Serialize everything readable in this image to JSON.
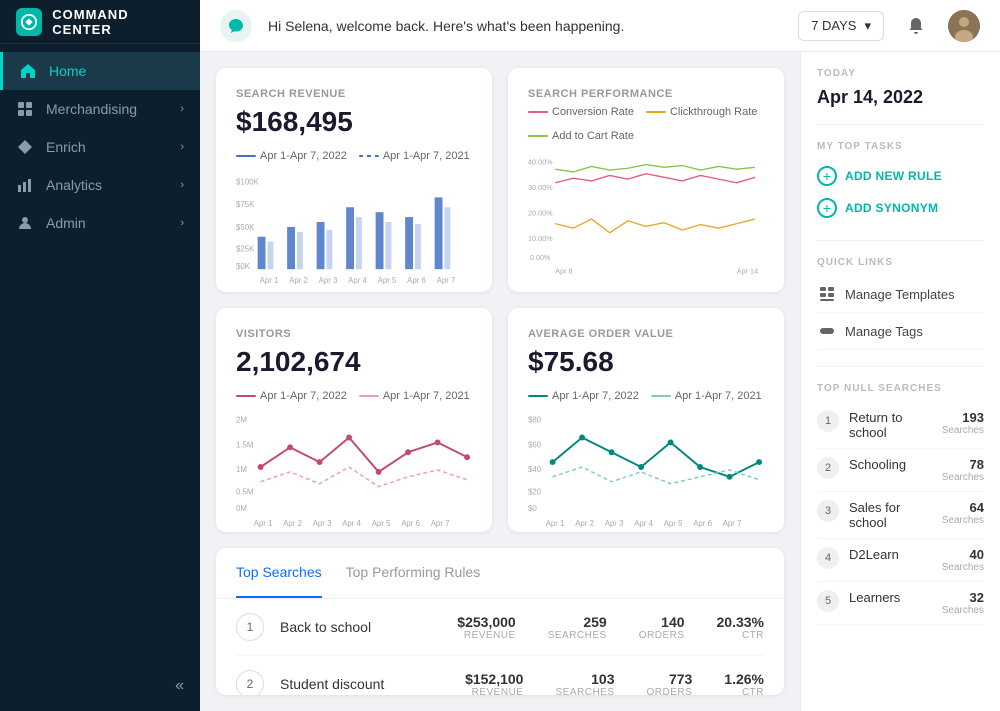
{
  "sidebar": {
    "title": "COMMAND CENTER",
    "items": [
      {
        "label": "Home",
        "active": true,
        "hasChevron": false
      },
      {
        "label": "Merchandising",
        "active": false,
        "hasChevron": true
      },
      {
        "label": "Enrich",
        "active": false,
        "hasChevron": true
      },
      {
        "label": "Analytics",
        "active": false,
        "hasChevron": true
      },
      {
        "label": "Admin",
        "active": false,
        "hasChevron": true
      }
    ]
  },
  "topbar": {
    "greeting": "Hi Selena, welcome back. Here's what's been happening.",
    "filter": "7 DAYS"
  },
  "cards": {
    "search_revenue": {
      "title": "SEARCH REVENUE",
      "value": "$168,495",
      "legend1": "Apr 1-Apr 7, 2022",
      "legend2": "Apr 1-Apr 7, 2021"
    },
    "search_performance": {
      "title": "SEARCH PERFORMANCE",
      "legend1": "Conversion Rate",
      "legend2": "Clickthrough Rate",
      "legend3": "Add to Cart Rate"
    },
    "visitors": {
      "title": "VISITORS",
      "value": "2,102,674",
      "legend1": "Apr 1-Apr 7, 2022",
      "legend2": "Apr 1-Apr 7, 2021"
    },
    "avg_order": {
      "title": "AVERAGE ORDER VALUE",
      "value": "$75.68",
      "legend1": "Apr 1-Apr 7, 2022",
      "legend2": "Apr 1-Apr 7, 2021"
    }
  },
  "bottom_tabs": [
    "Top Searches",
    "Top Performing Rules"
  ],
  "top_searches": [
    {
      "rank": 1,
      "name": "Back to school",
      "revenue": "$253,000",
      "searches": "259",
      "orders": "140",
      "ctr": "20.33%"
    },
    {
      "rank": 2,
      "name": "Student discount",
      "revenue": "$152,100",
      "searches": "103",
      "orders": "773",
      "ctr": "1.26%"
    }
  ],
  "right_panel": {
    "today_label": "TODAY",
    "date": "Apr 14, 2022",
    "tasks_label": "MY TOP TASKS",
    "add_rule": "ADD NEW RULE",
    "add_synonym": "ADD SYNONYM",
    "quick_links_label": "QUICK LINKS",
    "quick_links": [
      "Manage Templates",
      "Manage Tags"
    ],
    "null_searches_label": "TOP NULL SEARCHES",
    "null_searches": [
      {
        "rank": 1,
        "name": "Return to school",
        "count": "193",
        "label": "Searches"
      },
      {
        "rank": 2,
        "name": "Schooling",
        "count": "78",
        "label": "Searches"
      },
      {
        "rank": 3,
        "name": "Sales for school",
        "count": "64",
        "label": "Searches"
      },
      {
        "rank": 4,
        "name": "D2Learn",
        "count": "40",
        "label": "Searches"
      },
      {
        "rank": 5,
        "name": "Learners",
        "count": "32",
        "label": "Searches"
      }
    ]
  }
}
